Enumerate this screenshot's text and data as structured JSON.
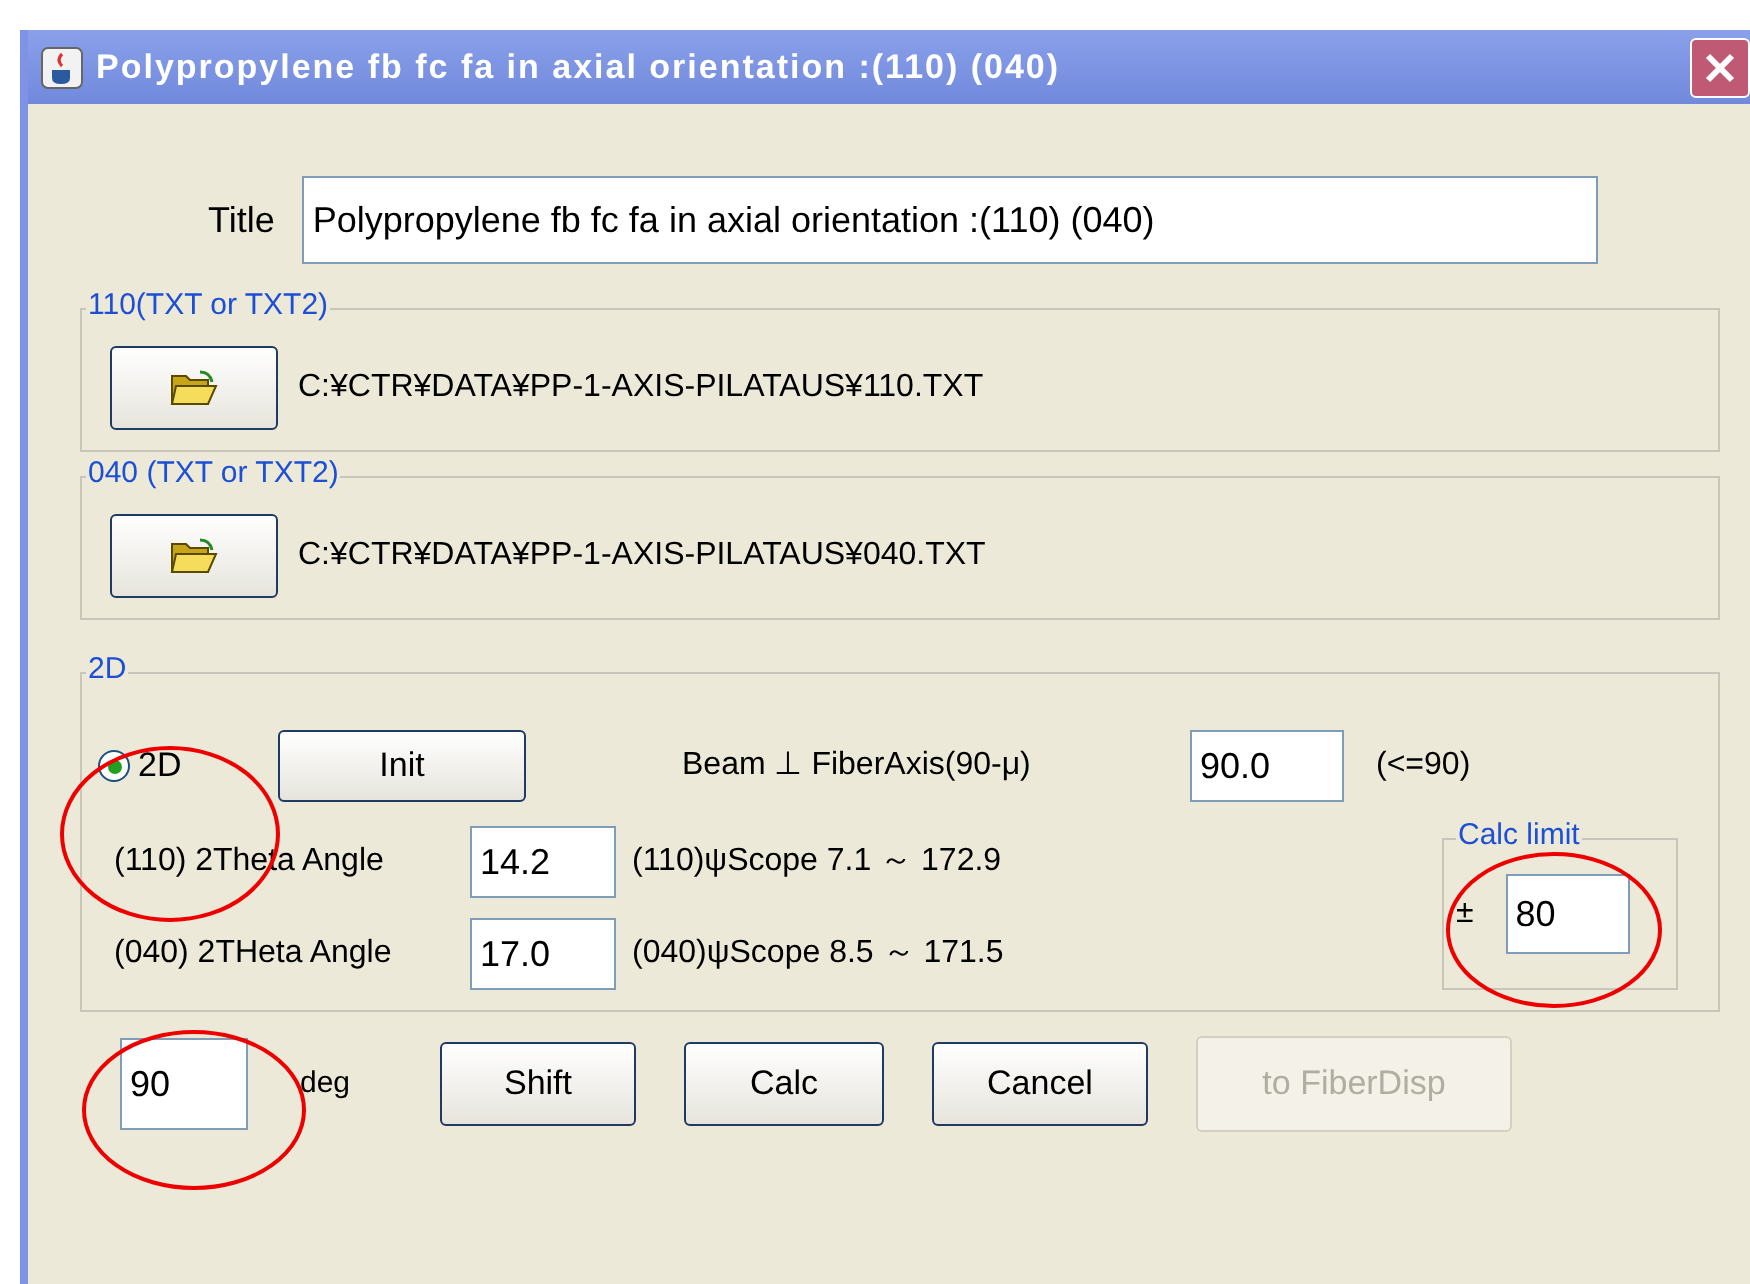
{
  "window": {
    "title": "Polypropylene fb fc fa in axial orientation :(110) (040)"
  },
  "title_field": {
    "label": "Title",
    "value": "Polypropylene fb fc fa in axial orientation :(110) (040)"
  },
  "file_groups": [
    {
      "legend": "110(TXT or TXT2)",
      "path": "C:¥CTR¥DATA¥PP-1-AXIS-PILATAUS¥110.TXT"
    },
    {
      "legend": "040 (TXT or TXT2)",
      "path": "C:¥CTR¥DATA¥PP-1-AXIS-PILATAUS¥040.TXT"
    }
  ],
  "mode_group": {
    "legend": "2D",
    "radio": {
      "label": "2D",
      "selected": true
    },
    "init_button": "Init",
    "beam_label": "Beam ⊥ FiberAxis(90-μ)",
    "beam_value": "90.0",
    "beam_hint": "(<=90)",
    "angles": [
      {
        "label": "(110) 2Theta Angle",
        "value": "14.2",
        "scope": "(110)ψScope 7.1 ～ 172.9"
      },
      {
        "label": "(040) 2THeta Angle",
        "value": "17.0",
        "scope": "(040)ψScope 8.5 ～ 171.5"
      }
    ],
    "calc_limit": {
      "legend": "Calc limit",
      "sign": "±",
      "value": "80"
    }
  },
  "shift_field": {
    "value": "90",
    "unit": "deg"
  },
  "buttons": [
    {
      "label": "Shift",
      "disabled": false
    },
    {
      "label": "Calc",
      "disabled": false
    },
    {
      "label": "Cancel",
      "disabled": false
    },
    {
      "label": "to FiberDisp",
      "disabled": true
    }
  ]
}
